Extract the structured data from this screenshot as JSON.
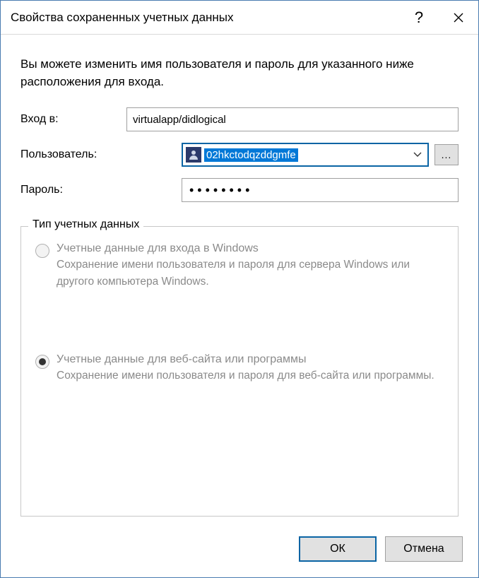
{
  "titlebar": {
    "title": "Свойства сохраненных учетных данных",
    "help": "?",
    "close": "✕"
  },
  "intro": "Вы можете изменить имя пользователя и пароль для указанного ниже расположения для входа.",
  "fields": {
    "login_label": "Вход в:",
    "login_value": "virtualapp/didlogical",
    "user_label": "Пользователь:",
    "user_value": "02hkctodqzddgmfe",
    "browse_label": "...",
    "password_label": "Пароль:",
    "password_value": "••••••••"
  },
  "group": {
    "legend": "Тип учетных данных",
    "opt1": {
      "title": "Учетные данные для входа в Windows",
      "desc": "Сохранение имени пользователя и пароля для сервера Windows или другого компьютера Windows."
    },
    "opt2": {
      "title": "Учетные данные для веб-сайта или программы",
      "desc": "Сохранение имени пользователя и пароля для веб-сайта или программы."
    }
  },
  "footer": {
    "ok": "ОК",
    "cancel": "Отмена"
  }
}
